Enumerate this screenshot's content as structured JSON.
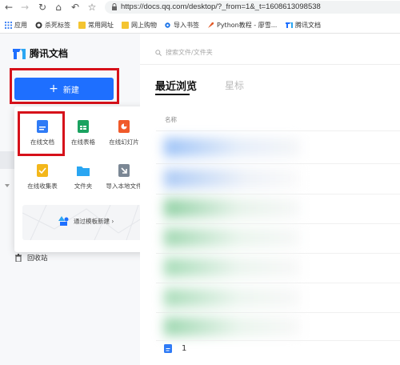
{
  "browser": {
    "url": "https://docs.qq.com/desktop/?_from=1&_t=1608613098538",
    "bookmarks": [
      {
        "label": "应用",
        "icon": "apps-grid-icon"
      },
      {
        "label": "杀死标签",
        "icon": "kill-tabs-icon"
      },
      {
        "label": "常用网址",
        "icon": "folder-icon"
      },
      {
        "label": "网上购物",
        "icon": "folder-icon"
      },
      {
        "label": "导入书签",
        "icon": "gear-icon"
      },
      {
        "label": "Python教程 - 廖雪...",
        "icon": "rocket-icon"
      },
      {
        "label": "腾讯文档",
        "icon": "tencent-docs-icon"
      }
    ]
  },
  "app": {
    "logo_text": "腾讯文档",
    "new_button": "新建",
    "search_placeholder": "搜索文件/文件夹",
    "tabs": [
      "最近浏览",
      "星标"
    ],
    "column_name": "名称",
    "recycle_bin": "回收站",
    "last_row_name": "1"
  },
  "new_menu": {
    "items": [
      {
        "label": "在线文档",
        "color": "#2f7bf6"
      },
      {
        "label": "在线表格",
        "color": "#1aa260"
      },
      {
        "label": "在线幻灯片",
        "color": "#f05a2a"
      },
      {
        "label": "在线收集表",
        "color": "#f3b71b"
      },
      {
        "label": "文件夹",
        "color": "#2aa6f2"
      },
      {
        "label": "导入本地文件",
        "color": "#7b8794"
      }
    ],
    "template_label": "通过模板新建 ›"
  },
  "colors": {
    "primary": "#1e6fff",
    "highlight": "#d6111a"
  }
}
